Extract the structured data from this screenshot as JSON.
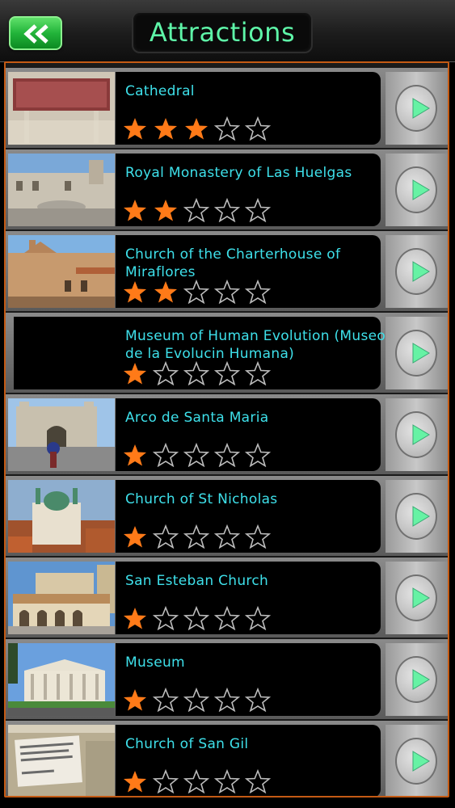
{
  "header": {
    "title": "Attractions",
    "back_icon": "double-chevron-left-icon",
    "accent_color": "#5ef5a8"
  },
  "list": {
    "items": [
      {
        "name": "Cathedral",
        "rating": 3,
        "max_rating": 5
      },
      {
        "name": "Royal Monastery of Las Huelgas",
        "rating": 2,
        "max_rating": 5
      },
      {
        "name": "Church of the Charterhouse of Miraflores",
        "rating": 2,
        "max_rating": 5
      },
      {
        "name": "Museum of Human Evolution (Museo de la Evolucin Humana)",
        "rating": 1,
        "max_rating": 5
      },
      {
        "name": "Arco de Santa Maria",
        "rating": 1,
        "max_rating": 5
      },
      {
        "name": "Church of St Nicholas",
        "rating": 1,
        "max_rating": 5
      },
      {
        "name": "San Esteban Church",
        "rating": 1,
        "max_rating": 5
      },
      {
        "name": "Museum",
        "rating": 1,
        "max_rating": 5
      },
      {
        "name": "Church of San Gil",
        "rating": 1,
        "max_rating": 5
      }
    ],
    "star_filled_color": "#ff7a18",
    "name_color": "#3ee0ea",
    "go_icon": "play-arrow-icon"
  }
}
